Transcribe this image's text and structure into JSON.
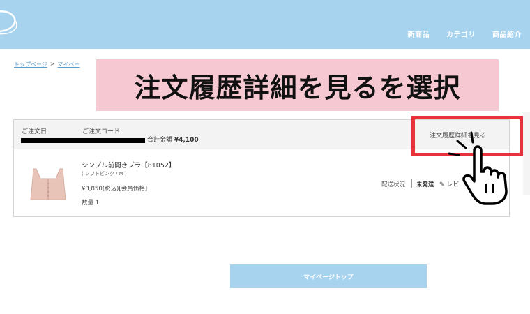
{
  "header": {
    "nav": [
      "新商品",
      "カテゴリ",
      "商品紹介"
    ]
  },
  "breadcrumb": {
    "home": "トップページ",
    "separator": ">",
    "mypage": "マイペー"
  },
  "banner": {
    "text": "注文履歴詳細を見るを選択"
  },
  "order": {
    "date_label": "ご注文日",
    "code_label": "ご注文コード",
    "total_label": "合計金額",
    "total_value": "¥4,100",
    "detail_link": "注文履歴詳細を見る",
    "product_name": "シンプル前開きブラ【81052】",
    "variant": "( ソフトピンク / M )",
    "price": "¥3,850(税込)[会員価格]",
    "qty_label": "数量",
    "qty": "1",
    "shipping_label": "配送状況",
    "shipping_value": "未発送",
    "review_label": "レビ"
  },
  "footer": {
    "mypage_button": "マイページトップ"
  },
  "colors": {
    "header": "#a7d3ef",
    "banner": "#f6c9d2",
    "highlight": "#e8323a"
  }
}
